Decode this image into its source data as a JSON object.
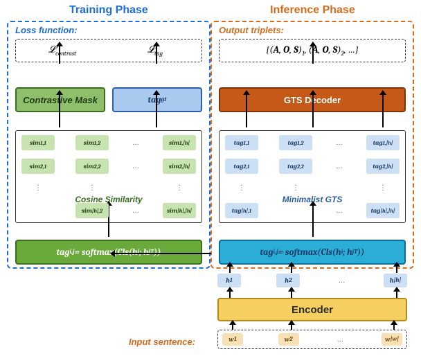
{
  "phases": {
    "training": "Training Phase",
    "inference": "Inference Phase"
  },
  "training": {
    "section_title": "Loss function:",
    "loss1": "ℒ_contrast",
    "loss2": "ℒ_tag",
    "contrast_mask": "Contrastive Mask",
    "tag_gt": "tag_gt",
    "grid_label": "Cosine Similarity",
    "softmax": "tagᵢ,ⱼ = softmax(Cls(hᵢ; hⱼᵀ))",
    "grid": {
      "r1": [
        "sim₁,₁",
        "sim₁,₂",
        "sim₁,|h|"
      ],
      "r2": [
        "sim₂,₁",
        "sim₂,₂",
        "sim₂,|h|"
      ],
      "r3": [
        "sim|h|,₂",
        "sim|h|,|h|"
      ]
    }
  },
  "inference": {
    "section_title": "Output triplets:",
    "triplets": "{(A, O, S)₁, (A, O, S)₂, …}",
    "gts_decoder": "GTS Decoder",
    "grid_label": "Minimalist GTS",
    "softmax": "tagᵢ,ⱼ = softmax(Cls(hᵢ; hⱼᵀ))",
    "grid": {
      "r1": [
        "tag₁,₁",
        "tag₁,₂",
        "tag₁,|h|"
      ],
      "r2": [
        "tag₂,₁",
        "tag₂,₂",
        "tag₂,|h|"
      ],
      "r3": [
        "tag|h|,₁",
        "tag|h|,|h|"
      ]
    }
  },
  "encoder": {
    "h": [
      "h₁",
      "h₂",
      "h|h|"
    ],
    "label": "Encoder",
    "input_label": "Input sentence:",
    "w": [
      "w₁",
      "w₂",
      "w|w|"
    ]
  },
  "dots": "…",
  "vdots": "⋮"
}
